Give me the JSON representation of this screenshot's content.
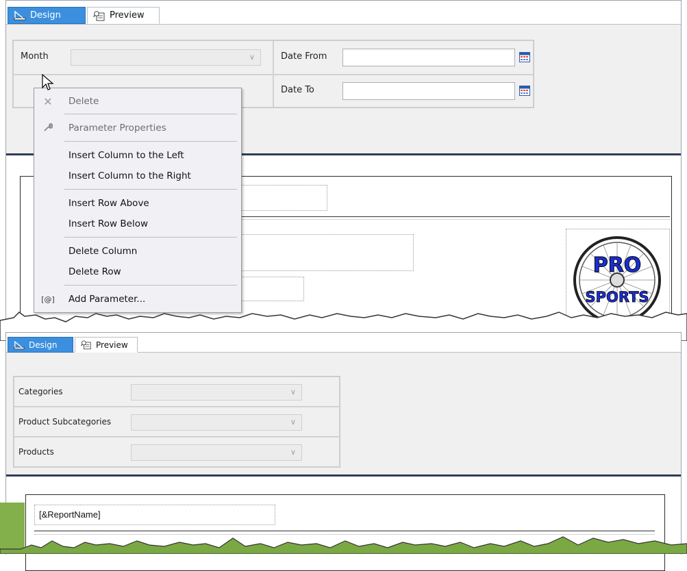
{
  "top_panel": {
    "tabs": {
      "design_label": "Design",
      "preview_label": "Preview"
    },
    "params": {
      "month_label": "Month",
      "month_value": "",
      "date_from_label": "Date From",
      "date_from_value": "",
      "date_to_label": "Date To",
      "date_to_value": ""
    },
    "context_menu": {
      "items": [
        {
          "label": "Delete",
          "icon": "delete-x-icon",
          "enabled": false
        },
        {
          "label": "Parameter Properties",
          "icon": "wrench-icon",
          "enabled": false
        },
        {
          "label": "Insert Column to the Left",
          "enabled": true
        },
        {
          "label": "Insert Column to the Right",
          "enabled": true
        },
        {
          "label": "Insert Row Above",
          "enabled": true
        },
        {
          "label": "Insert Row Below",
          "enabled": true
        },
        {
          "label": "Delete Column",
          "enabled": true
        },
        {
          "label": "Delete Row",
          "enabled": true
        },
        {
          "label": "Add Parameter...",
          "icon_text": "[@]",
          "enabled": true
        }
      ]
    },
    "logo": {
      "line1": "PRO",
      "line2": "SPORTS"
    }
  },
  "bottom_panel": {
    "tabs": {
      "design_label": "Design",
      "preview_label": "Preview"
    },
    "params": {
      "categories_label": "Categories",
      "subcategories_label": "Product Subcategories",
      "products_label": "Products"
    },
    "report_name_field": "[&ReportName]"
  },
  "colors": {
    "active_tab": "#3c8fde",
    "param_area": "#f0f0f0",
    "navy_rule": "#2e3d55",
    "menu_bg": "#f1f1f5",
    "logo_blue": "#1a2fd6"
  }
}
